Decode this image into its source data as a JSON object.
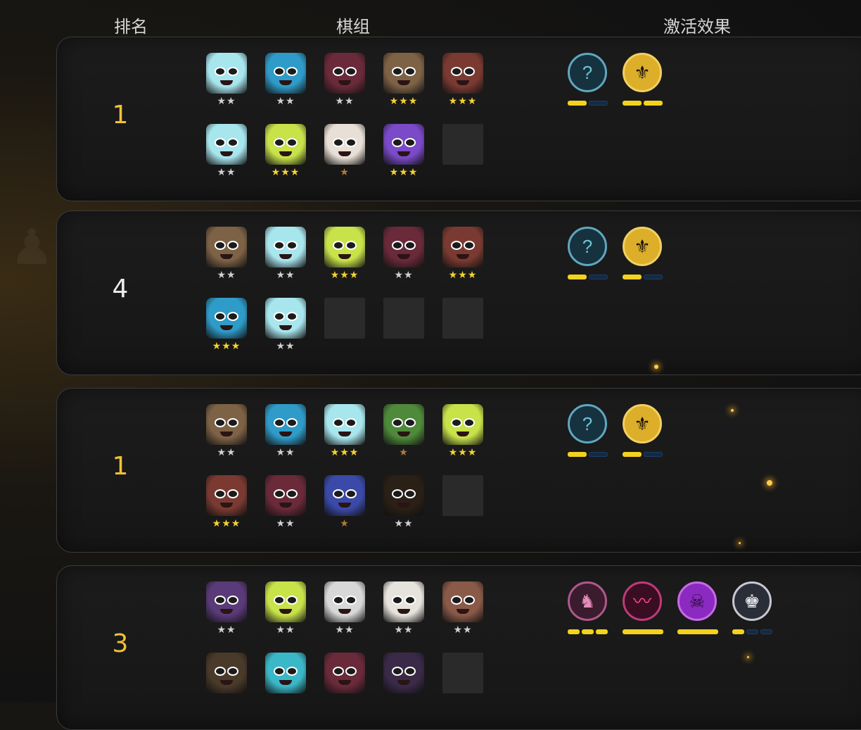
{
  "header": {
    "rank": "排名",
    "team": "棋组",
    "effects": "激活效果"
  },
  "rows": [
    {
      "rank": "1",
      "rank_color": "gold",
      "pieces": [
        [
          {
            "color": "#a8e6ee",
            "stars": "★★",
            "tier": "silver"
          },
          {
            "color": "#2f9bc8",
            "stars": "★★",
            "tier": "silver"
          },
          {
            "color": "#6a2a3a",
            "stars": "★★",
            "tier": "silver"
          },
          {
            "color": "#7d6246",
            "stars": "★★★",
            "tier": "gold"
          },
          {
            "color": "#7a3a32",
            "stars": "★★★",
            "tier": "gold"
          }
        ],
        [
          {
            "color": "#a8e6ee",
            "stars": "★★",
            "tier": "silver"
          },
          {
            "color": "#c8e24a",
            "stars": "★★★",
            "tier": "gold"
          },
          {
            "color": "#e8e0d6",
            "stars": "★",
            "tier": "bronze"
          },
          {
            "color": "#7a4ac8",
            "stars": "★★★",
            "tier": "gold"
          },
          {
            "empty": true
          }
        ]
      ],
      "effects": [
        {
          "icon": "mystery-rune-icon",
          "glyph": "?",
          "bg": "#16323e",
          "ring": "#5fa7c0",
          "fg": "#6ec3d8",
          "bars": [
            1,
            0
          ]
        },
        {
          "icon": "gold-emblem-icon",
          "glyph": "⚜",
          "bg": "#dcae2a",
          "ring": "#f2d060",
          "fg": "#1a1206",
          "bars": [
            1,
            1
          ]
        }
      ]
    },
    {
      "rank": "4",
      "rank_color": "white",
      "pieces": [
        [
          {
            "color": "#7d6246",
            "stars": "★★",
            "tier": "silver"
          },
          {
            "color": "#a8e6ee",
            "stars": "★★",
            "tier": "silver"
          },
          {
            "color": "#c8e24a",
            "stars": "★★★",
            "tier": "gold"
          },
          {
            "color": "#6a2a3a",
            "stars": "★★",
            "tier": "silver"
          },
          {
            "color": "#7a3a32",
            "stars": "★★★",
            "tier": "gold"
          }
        ],
        [
          {
            "color": "#2f9bc8",
            "stars": "★★★",
            "tier": "gold"
          },
          {
            "color": "#a8e6ee",
            "stars": "★★",
            "tier": "silver"
          },
          {
            "empty": true
          },
          {
            "empty": true
          },
          {
            "empty": true
          }
        ]
      ],
      "effects": [
        {
          "icon": "mystery-rune-icon",
          "glyph": "?",
          "bg": "#16323e",
          "ring": "#5fa7c0",
          "fg": "#6ec3d8",
          "bars": [
            1,
            0
          ]
        },
        {
          "icon": "gold-emblem-icon",
          "glyph": "⚜",
          "bg": "#dcae2a",
          "ring": "#f2d060",
          "fg": "#1a1206",
          "bars": [
            1,
            0
          ]
        }
      ]
    },
    {
      "rank": "1",
      "rank_color": "gold",
      "pieces": [
        [
          {
            "color": "#7d6246",
            "stars": "★★",
            "tier": "silver"
          },
          {
            "color": "#2f9bc8",
            "stars": "★★",
            "tier": "silver"
          },
          {
            "color": "#a8e6ee",
            "stars": "★★★",
            "tier": "gold"
          },
          {
            "color": "#4e8a3a",
            "stars": "★",
            "tier": "bronze"
          },
          {
            "color": "#c8e24a",
            "stars": "★★★",
            "tier": "gold"
          }
        ],
        [
          {
            "color": "#7a3a32",
            "stars": "★★★",
            "tier": "gold"
          },
          {
            "color": "#6a2a3a",
            "stars": "★★",
            "tier": "silver"
          },
          {
            "color": "#3b4aa8",
            "stars": "★",
            "tier": "bronze"
          },
          {
            "color": "#2a2016",
            "stars": "★★",
            "tier": "silver"
          },
          {
            "empty": true
          }
        ]
      ],
      "effects": [
        {
          "icon": "mystery-rune-icon",
          "glyph": "?",
          "bg": "#16323e",
          "ring": "#5fa7c0",
          "fg": "#6ec3d8",
          "bars": [
            1,
            0
          ]
        },
        {
          "icon": "gold-emblem-icon",
          "glyph": "⚜",
          "bg": "#dcae2a",
          "ring": "#f2d060",
          "fg": "#1a1206",
          "bars": [
            1,
            0
          ]
        }
      ]
    },
    {
      "rank": "3",
      "rank_color": "gold",
      "pieces": [
        [
          {
            "color": "#5a3a78",
            "stars": "★★",
            "tier": "silver"
          },
          {
            "color": "#c8e24a",
            "stars": "★★",
            "tier": "silver"
          },
          {
            "color": "#d8d8d8",
            "stars": "★★",
            "tier": "silver"
          },
          {
            "color": "#e6e2dc",
            "stars": "★★",
            "tier": "silver"
          },
          {
            "color": "#8a5a48",
            "stars": "★★",
            "tier": "silver"
          }
        ],
        [
          {
            "color": "#4a3a2a",
            "stars": "",
            "tier": "silver"
          },
          {
            "color": "#3ab8c8",
            "stars": "",
            "tier": "silver"
          },
          {
            "color": "#6a2a3a",
            "stars": "",
            "tier": "silver"
          },
          {
            "color": "#3a2a48",
            "stars": "",
            "tier": "silver"
          },
          {
            "empty": true
          }
        ]
      ],
      "effects": [
        {
          "icon": "knight-icon",
          "glyph": "♞",
          "bg": "#3a1c2e",
          "ring": "#b0588a",
          "fg": "#e48cbc",
          "bars": [
            1,
            1,
            1
          ]
        },
        {
          "icon": "bat-icon",
          "glyph": "〰",
          "bg": "#3a0e22",
          "ring": "#c03a7a",
          "fg": "#ff4a8e",
          "bars": [
            2
          ]
        },
        {
          "icon": "demon-skull-icon",
          "glyph": "☠",
          "bg": "#8a2ac0",
          "ring": "#c76ae8",
          "fg": "#2a0a36",
          "bars": [
            2
          ]
        },
        {
          "icon": "crown-pedestal-icon",
          "glyph": "♚",
          "bg": "#2a2e38",
          "ring": "#c8c8d0",
          "fg": "#e0e0e6",
          "bars": [
            1,
            0,
            0
          ]
        }
      ]
    }
  ]
}
